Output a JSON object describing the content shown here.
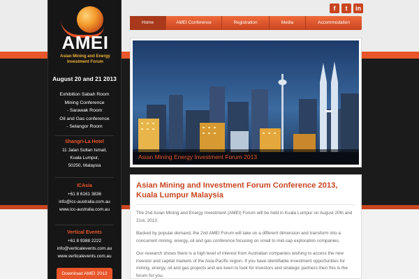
{
  "logo": {
    "title": "AMEI",
    "subtitle": "Asian Mining and Energy Investment Forum"
  },
  "sidebar": {
    "date": "August 20 and 21 2013",
    "venue_lines": [
      "Exhibition Sabah Room",
      "Mining Conference",
      "- Sarawak Room",
      "Oil and Gas conference",
      "- Selangor Room"
    ],
    "hotel": {
      "heading": "Shangri-La Hotel",
      "lines": [
        "11 Jalan Sultan Ismail,",
        "Kuala Lumpur,",
        "50250, Malaysia"
      ]
    },
    "icasia": {
      "heading": "ICAsia",
      "lines": [
        "+61 8 6161 3836",
        "info@icc-australia.com.au",
        "www.icc-australia.com.au"
      ]
    },
    "vertical": {
      "heading": "Vertical Events",
      "lines": [
        "+61 8 9388 2222",
        "info@verticalevents.com.au",
        "www.verticalevents.com.au"
      ]
    },
    "download_label": "Download AMEI 2012"
  },
  "social": {
    "facebook": "f",
    "twitter": "t",
    "linkedin": "in"
  },
  "nav": {
    "items": [
      "Home",
      "AMEI Conference",
      "Registration",
      "Media",
      "Accommodation"
    ],
    "active_index": 0
  },
  "hero": {
    "caption": "Asian Mining Energy Investment Forum 2013"
  },
  "content": {
    "title": "Asian Mining and Investment Forum Conference 2013, Kuala Lumpur Malaysia",
    "paragraphs": [
      "The 2nd Asian Mining and Energy Investment (AMEI) Forum will be held in Kuala Lumpur on August 20th and 21st, 2013.",
      "Backed by popular demand, the 2nd AMEI Forum will take on a different dimension and transform into a concurrent mining, energy, oil and gas conference focusing on small to mid-cap exploration companies.",
      "Our research shows there is a high level of interest from Australian companies wishing to access the new investor and capital markets of the Asia-Pacific region. If you have identifiable investment opportunities for mining, energy, oil and gas projects and are keen to look for investors and strategic partners then this is the forum for you."
    ]
  },
  "colors": {
    "accent": "#e8562a",
    "dark": "#161616",
    "title": "#c94521"
  }
}
